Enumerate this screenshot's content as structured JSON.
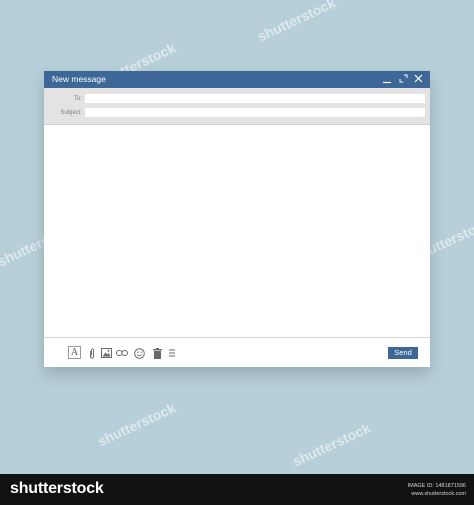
{
  "compose_window": {
    "title": "New message",
    "controls": {
      "minimize": "minimize-icon",
      "maximize": "expand-icon",
      "close": "close-icon"
    },
    "to_label": "To:",
    "to_value": "",
    "subject_label": "Subject:",
    "subject_value": "",
    "body_value": "",
    "toolbar": {
      "icons": [
        "text-format-icon",
        "attachment-icon",
        "image-icon",
        "link-icon",
        "emoji-icon",
        "trash-icon",
        "more-icon"
      ],
      "format_glyph": "A",
      "send_label": "Send"
    },
    "accent_color": "#3d6796"
  },
  "stock_footer": {
    "logo_text": "shutterstock",
    "image_id": "IMAGE ID: 1481871596",
    "site": "www.shutterstock.com"
  }
}
